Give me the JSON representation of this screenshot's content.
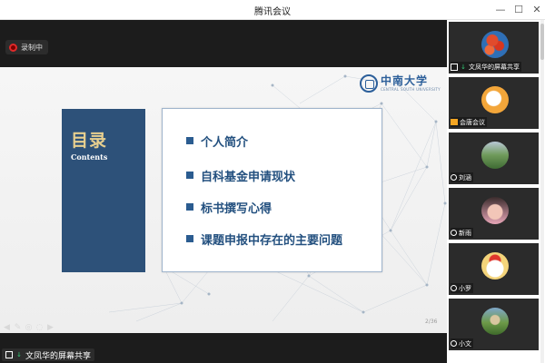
{
  "window": {
    "title": "腾讯会议",
    "minimize_glyph": "—",
    "maximize_glyph": "☐",
    "close_glyph": "✕"
  },
  "recording": {
    "label": "录制中",
    "color": "#e02a2a"
  },
  "slide": {
    "logo_cn": "中南大学",
    "logo_en": "CENTRAL SOUTH UNIVERSITY",
    "toc_title": "目录",
    "toc_subtitle": "Contents",
    "items": [
      "个人简介",
      "自科基金申请现状",
      "标书撰写心得",
      "课题申报中存在的主要问题"
    ],
    "page": "2/36",
    "accent": "#2d5179",
    "gold": "#e7cf8f"
  },
  "share": {
    "label": "文凤华的屏幕共享",
    "icons": [
      "screen-share-icon",
      "mic-on-icon"
    ]
  },
  "participants": [
    {
      "name": "文凤华的屏幕共享",
      "avatar": "red-flowers-avatar",
      "badge": "screen-share-icon"
    },
    {
      "name": "会唐会议",
      "avatar": "cartoon-avatar",
      "badge": "camera-icon"
    },
    {
      "name": "刘涵",
      "avatar": "landscape-avatar",
      "badge": "person-icon"
    },
    {
      "name": "新雨",
      "avatar": "portrait-avatar",
      "badge": "person-icon"
    },
    {
      "name": "小罗",
      "avatar": "cartoon-face-avatar",
      "badge": "person-icon"
    },
    {
      "name": "小文",
      "avatar": "outdoor-avatar",
      "badge": "person-icon"
    }
  ]
}
